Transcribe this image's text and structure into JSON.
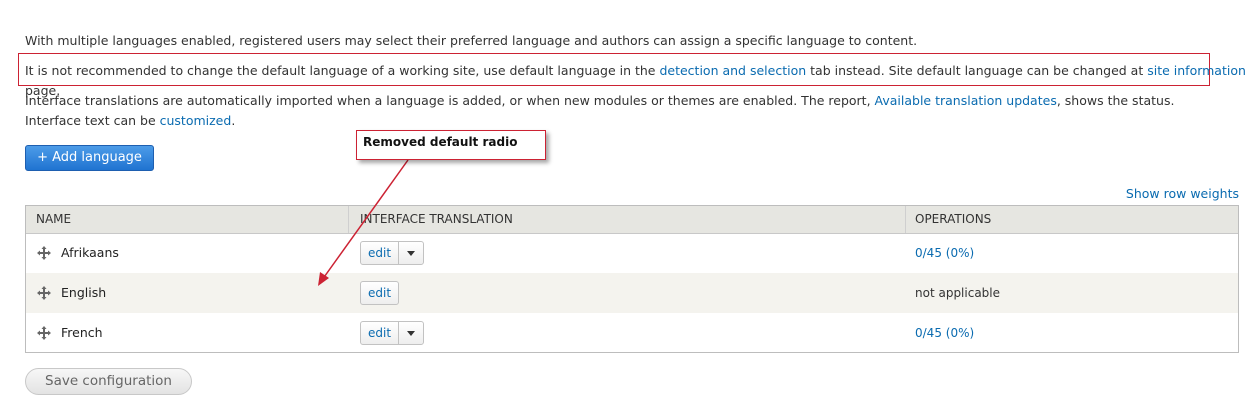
{
  "intro": {
    "p1": "With multiple languages enabled, registered users may select their preferred language and authors can assign a specific language to content.",
    "p2_before": "It is not recommended to change the default language of a working site, use default language in the ",
    "p2_link1": "detection and selection",
    "p2_middle": " tab instead. Site default language can be changed at ",
    "p2_link2": "site information",
    "p2_after": " page.",
    "p3_before": "Interface translations are automatically imported when a language is added, or when new modules or themes are enabled. The report, ",
    "p3_link1": "Available translation updates",
    "p3_middle": ", shows the status. Interface text can be ",
    "p3_link2": "customized",
    "p3_after": "."
  },
  "add_language_label": "+ Add language",
  "show_row_weights": "Show row weights",
  "table": {
    "headers": [
      "NAME",
      "INTERFACE TRANSLATION",
      "OPERATIONS"
    ],
    "rows": [
      {
        "name": "Afrikaans",
        "edit": "edit",
        "has_dropdown": true,
        "operation": "0/45 (0%)",
        "operation_is_link": true
      },
      {
        "name": "English",
        "edit": "edit",
        "has_dropdown": false,
        "operation": "not applicable",
        "operation_is_link": false
      },
      {
        "name": "French",
        "edit": "edit",
        "has_dropdown": true,
        "operation": "0/45 (0%)",
        "operation_is_link": true
      }
    ]
  },
  "annotation": {
    "callout_text": "Removed default radio",
    "color": "#cc2233"
  },
  "save_label": "Save configuration",
  "colors": {
    "link": "#0a6bb0",
    "primary_button": "#1f73d1"
  }
}
